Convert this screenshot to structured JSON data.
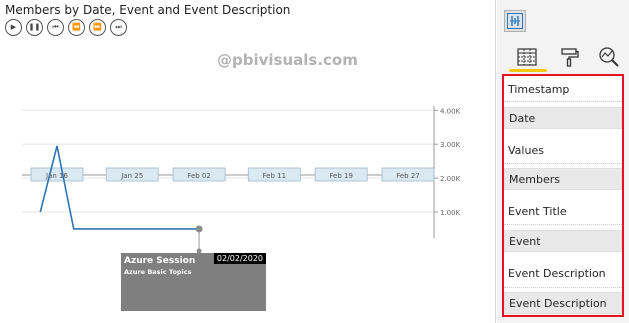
{
  "visual": {
    "title": "Members by Date, Event and Event Description",
    "watermark": "@pbivisuals.com",
    "controls": [
      {
        "name": "play-button",
        "glyph": "▶"
      },
      {
        "name": "pause-button",
        "glyph": "❚❚"
      },
      {
        "name": "skip-to-start-button",
        "glyph": "⏮"
      },
      {
        "name": "step-back-button",
        "glyph": "⏪"
      },
      {
        "name": "step-forward-button",
        "glyph": "⏩"
      },
      {
        "name": "skip-to-end-button",
        "glyph": "⏭"
      }
    ],
    "tooltip": {
      "title": "Azure Session",
      "subtitle": "Azure Basic Topics",
      "date": "02/02/2020"
    }
  },
  "chart_data": {
    "type": "line",
    "x_tick_labels": [
      "Jan 16",
      "Jan 25",
      "Feb 02",
      "Feb 11",
      "Feb 19",
      "Feb 27"
    ],
    "y_tick_labels": [
      "4.00K",
      "3.00K",
      "2.00K",
      "1.00K"
    ],
    "ylim": [
      0,
      4000
    ],
    "series": [
      {
        "color": "#2e75b6",
        "points": [
          {
            "x": "2020-01-14",
            "y": 1000
          },
          {
            "x": "2020-01-16",
            "y": 2950
          },
          {
            "x": "2020-01-18",
            "y": 500
          },
          {
            "x": "2020-02-02",
            "y": 500
          }
        ]
      }
    ],
    "gridlines": true,
    "highlight_point": {
      "x": "2020-02-02",
      "y": 500
    }
  },
  "pane": {
    "tabs": [
      {
        "name": "fields-tab",
        "icon": "fields-icon"
      },
      {
        "name": "format-tab",
        "icon": "paint-roller-icon"
      },
      {
        "name": "analytics-tab",
        "icon": "analytics-icon"
      }
    ],
    "wells": [
      {
        "label": "Timestamp",
        "kind": "label"
      },
      {
        "label": "Date",
        "kind": "field"
      },
      {
        "label": "Values",
        "kind": "label"
      },
      {
        "label": "Members",
        "kind": "field"
      },
      {
        "label": "Event Title",
        "kind": "label"
      },
      {
        "label": "Event",
        "kind": "field"
      },
      {
        "label": "Event Description",
        "kind": "label"
      },
      {
        "label": "Event Description",
        "kind": "field"
      }
    ],
    "highlight_color": "#e81123"
  }
}
